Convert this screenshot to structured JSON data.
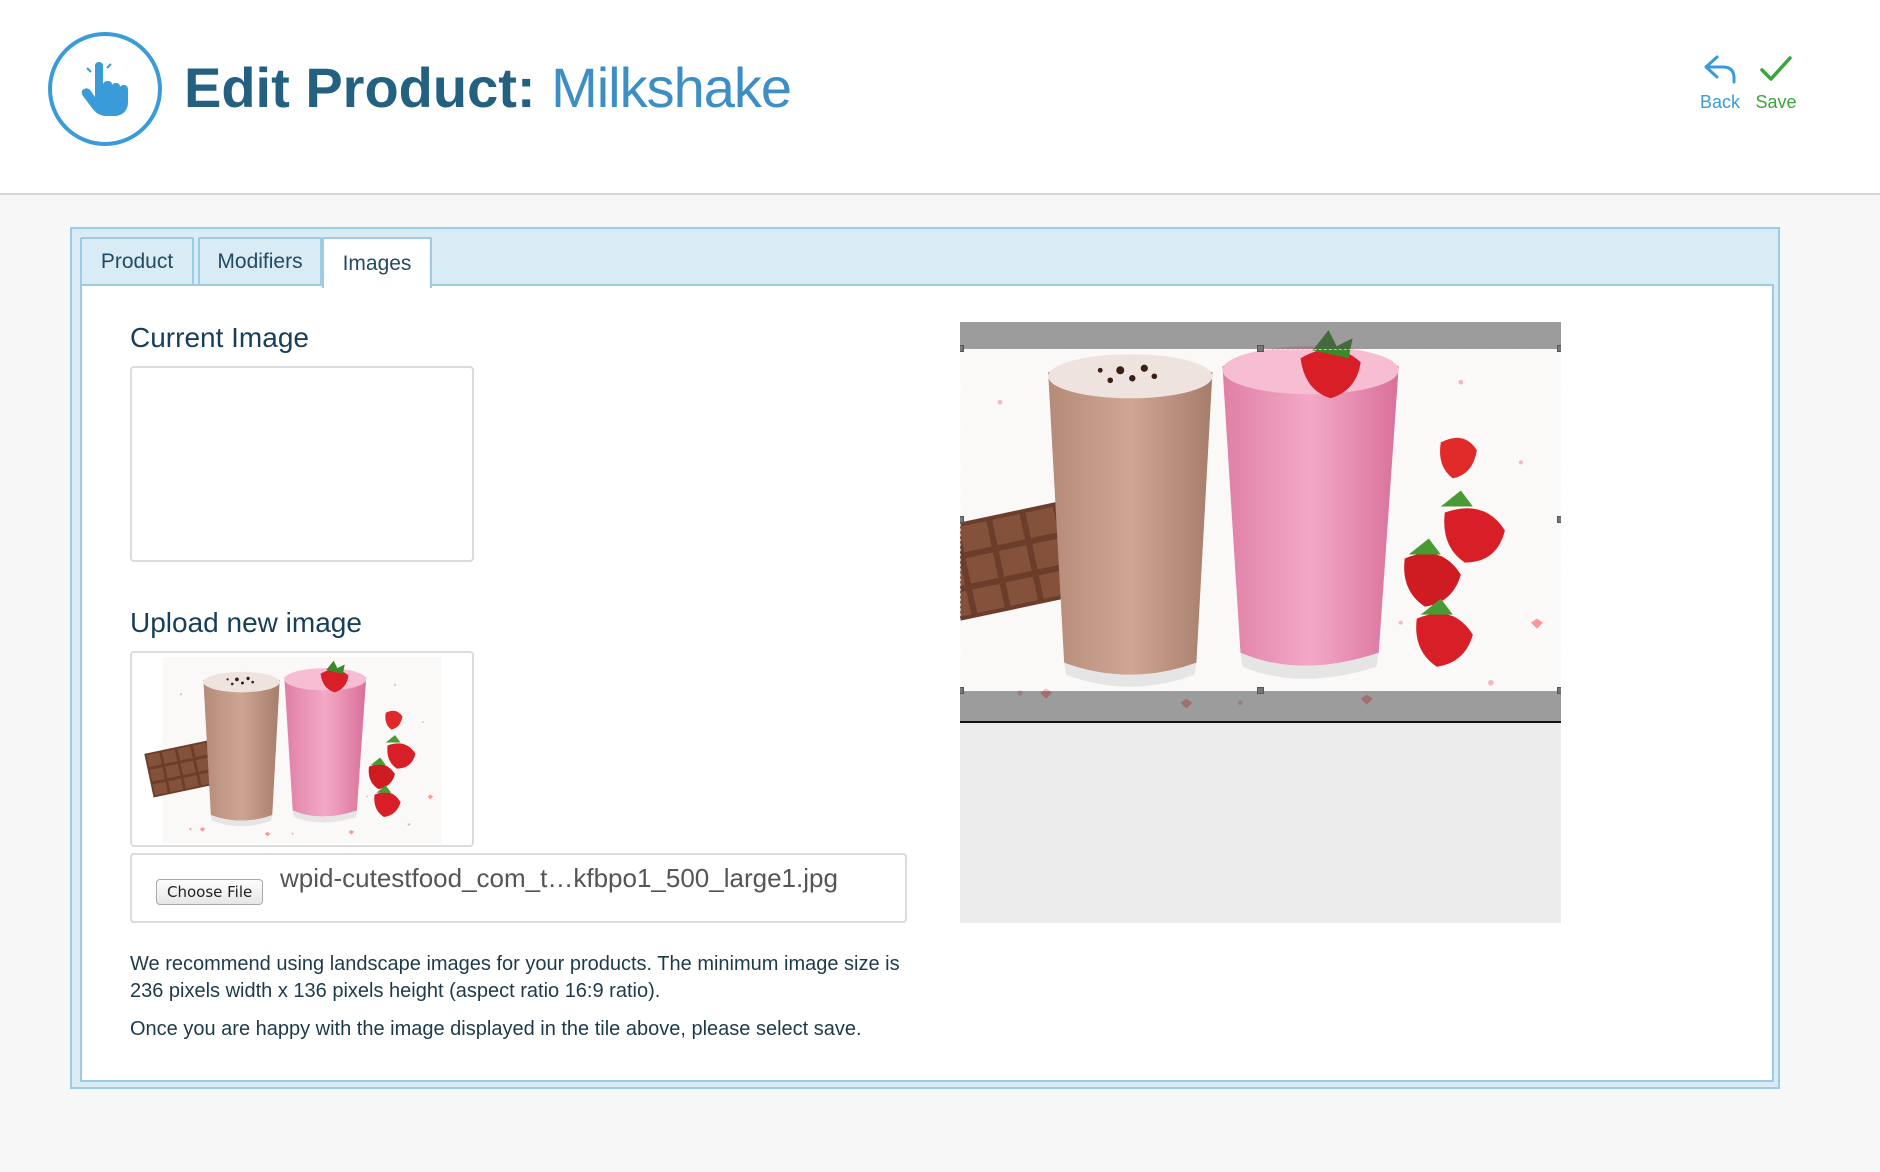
{
  "header": {
    "title_prefix": "Edit Product:",
    "title_name": "Milkshake",
    "back_label": "Back",
    "save_label": "Save"
  },
  "tabs": [
    {
      "label": "Product",
      "active": false
    },
    {
      "label": "Modifiers",
      "active": false
    },
    {
      "label": "Images",
      "active": true
    }
  ],
  "images": {
    "current_heading": "Current Image",
    "upload_heading": "Upload new image",
    "choose_file_label": "Choose File",
    "file_name": "wpid-cutestfood_com_t…kfbpo1_500_large1.jpg",
    "note_1": "We recommend using landscape images for your products. The minimum image size is 236 pixels width x 136 pixels height (aspect ratio 16:9 ratio).",
    "note_2": "Once you are happy with the image displayed in the tile above, please select save."
  },
  "colors": {
    "accent": "#3a9bd9",
    "title_dark": "#24607f",
    "save_green": "#3aa53a",
    "panel_bg": "#d9ecf5",
    "panel_border": "#9dcbe3"
  },
  "icons": {
    "logo": "hand-pointer-icon",
    "back": "reply-arrow-icon",
    "save": "checkmark-icon"
  }
}
